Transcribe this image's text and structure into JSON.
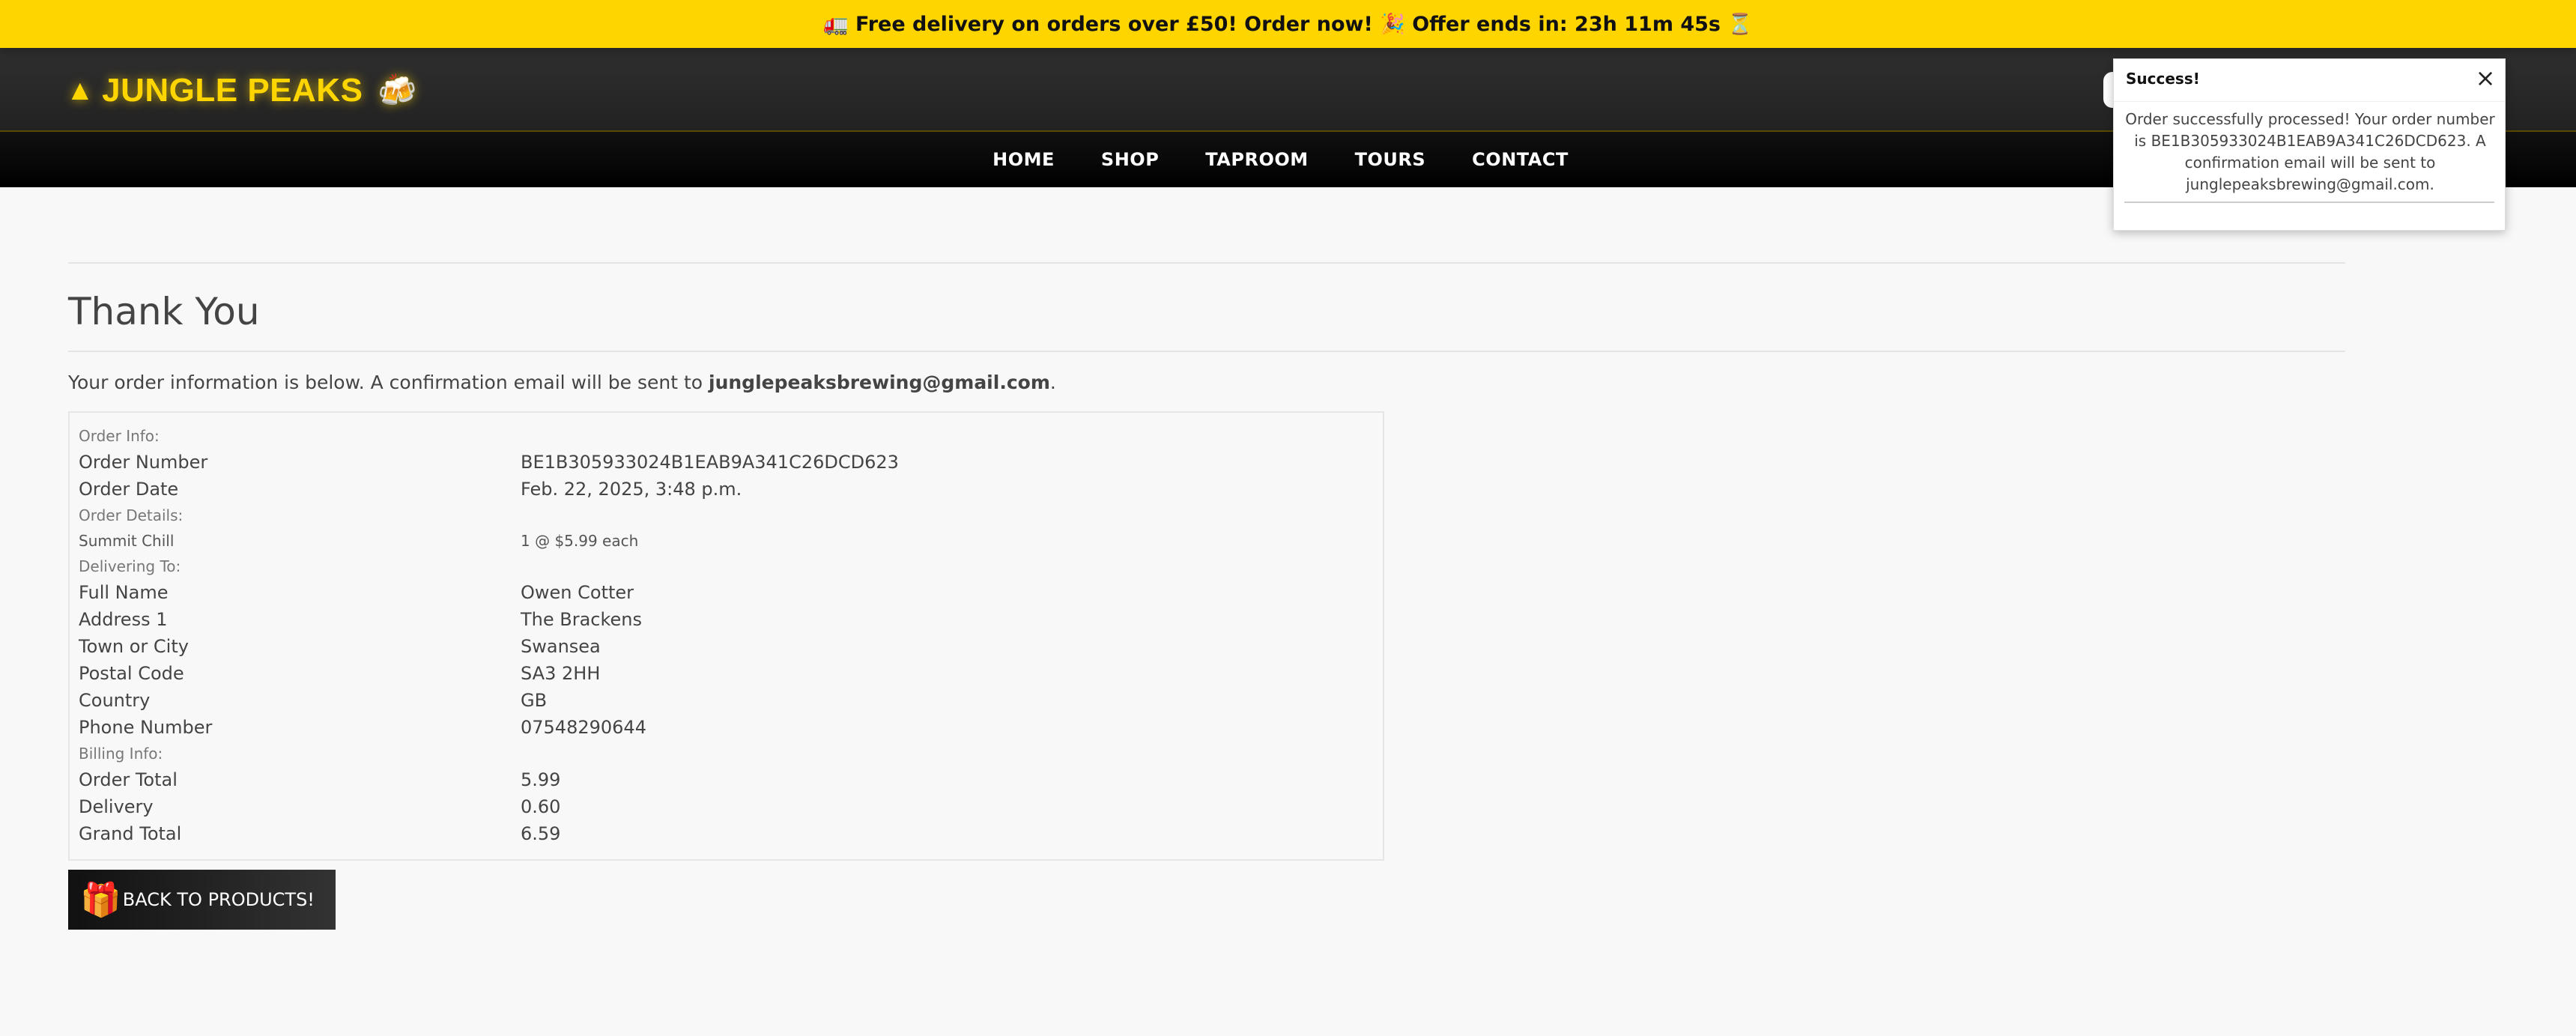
{
  "promo": {
    "text": "🚛 Free delivery on orders over £50! Order now! 🎉 Offer ends in: 23h 11m 45s ⏳"
  },
  "header": {
    "brand": "JUNGLE PEAKS",
    "brand_icon": "warning-triangle-icon",
    "brand_emoji": "🍻"
  },
  "nav": {
    "items": [
      {
        "label": "HOME"
      },
      {
        "label": "SHOP"
      },
      {
        "label": "TAPROOM"
      },
      {
        "label": "TOURS"
      },
      {
        "label": "CONTACT"
      }
    ]
  },
  "page": {
    "title": "Thank You",
    "intro_prefix": "Your order information is below. A confirmation email will be sent to ",
    "email": "junglepeaksbrewing@gmail.com",
    "intro_suffix": "."
  },
  "order": {
    "order_info_heading": "Order Info:",
    "order_number_label": "Order Number",
    "order_number": "BE1B305933024B1EAB9A341C26DCD623",
    "order_date_label": "Order Date",
    "order_date": "Feb. 22, 2025, 3:48 p.m.",
    "order_details_heading": "Order Details:",
    "item_name": "Summit Chill",
    "item_qty_price": "1 @ $5.99 each",
    "delivering_heading": "Delivering To:",
    "full_name_label": "Full Name",
    "full_name": "Owen Cotter",
    "address1_label": "Address 1",
    "address1": "The Brackens",
    "town_label": "Town or City",
    "town": "Swansea",
    "postal_label": "Postal Code",
    "postal": "SA3 2HH",
    "country_label": "Country",
    "country": "GB",
    "phone_label": "Phone Number",
    "phone": "07548290644",
    "billing_heading": "Billing Info:",
    "order_total_label": "Order Total",
    "order_total": "5.99",
    "delivery_label": "Delivery",
    "delivery": "0.60",
    "grand_total_label": "Grand Total",
    "grand_total": "6.59"
  },
  "back_button": {
    "label": "BACK TO PRODUCTS!",
    "icon": "gift-icon"
  },
  "toast": {
    "title": "Success!",
    "message": "Order successfully processed! Your order number is BE1B305933024B1EAB9A341C26DCD623. A confirmation email will be sent to junglepeaksbrewing@gmail.com."
  },
  "colors": {
    "accent": "#ffd500",
    "header_bg": "#2a2a2a",
    "nav_bg": "#000000",
    "page_bg": "#f8f8f8"
  }
}
